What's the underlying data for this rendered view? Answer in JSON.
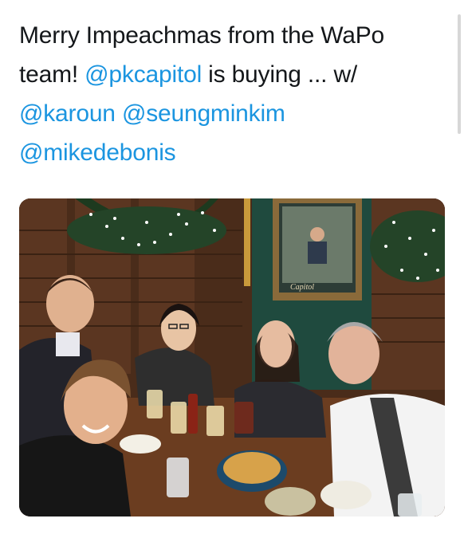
{
  "tweet": {
    "lines": [
      [
        {
          "text": "Merry Impeachmas from the WaPo",
          "mention": false
        }
      ],
      [
        {
          "text": "team! ",
          "mention": false
        },
        {
          "text": "@pkcapitol",
          "mention": true
        },
        {
          "text": " is buying ... w/",
          "mention": false
        }
      ],
      [
        {
          "text": "@karoun",
          "mention": true
        },
        {
          "text": " ",
          "mention": false
        },
        {
          "text": "@seungminkim",
          "mention": true
        }
      ],
      [
        {
          "text": "@mikedebonis",
          "mention": true
        }
      ]
    ]
  },
  "photo": {
    "description_icon": "group-photo",
    "sign_text": "Capitol"
  },
  "colors": {
    "text": "#14171a",
    "mention": "#1b95e0"
  }
}
